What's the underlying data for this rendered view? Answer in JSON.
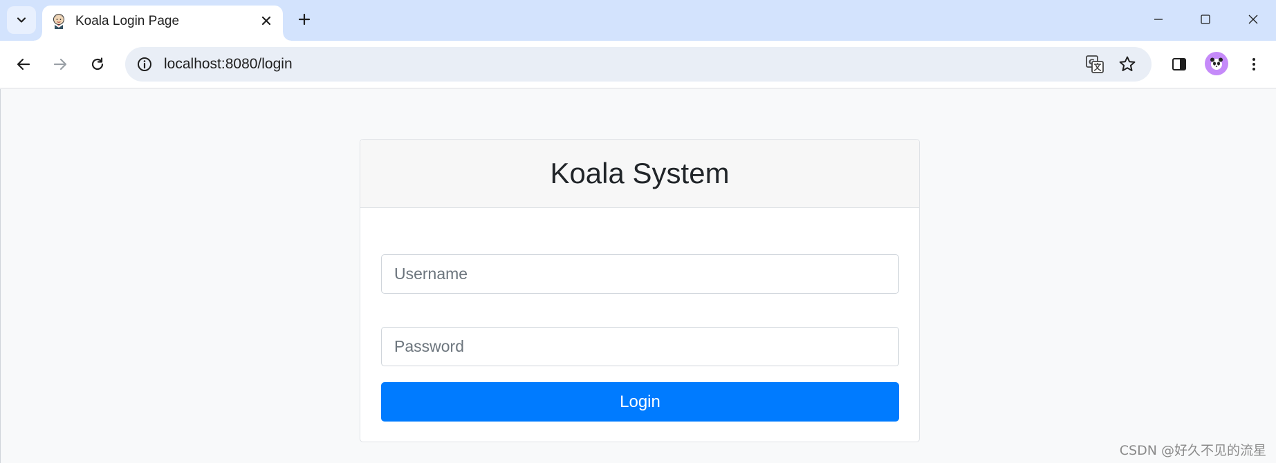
{
  "browser": {
    "tab": {
      "title": "Koala Login Page"
    },
    "address": {
      "url": "localhost:8080/login"
    }
  },
  "page": {
    "card_title": "Koala System",
    "username": {
      "placeholder": "Username",
      "value": ""
    },
    "password": {
      "placeholder": "Password",
      "value": ""
    },
    "login_label": "Login"
  },
  "watermark": "CSDN @好久不见的流星",
  "colors": {
    "primary_button": "#007bff",
    "tabstrip": "#d3e3fd",
    "page_bg": "#f8f9fa"
  }
}
